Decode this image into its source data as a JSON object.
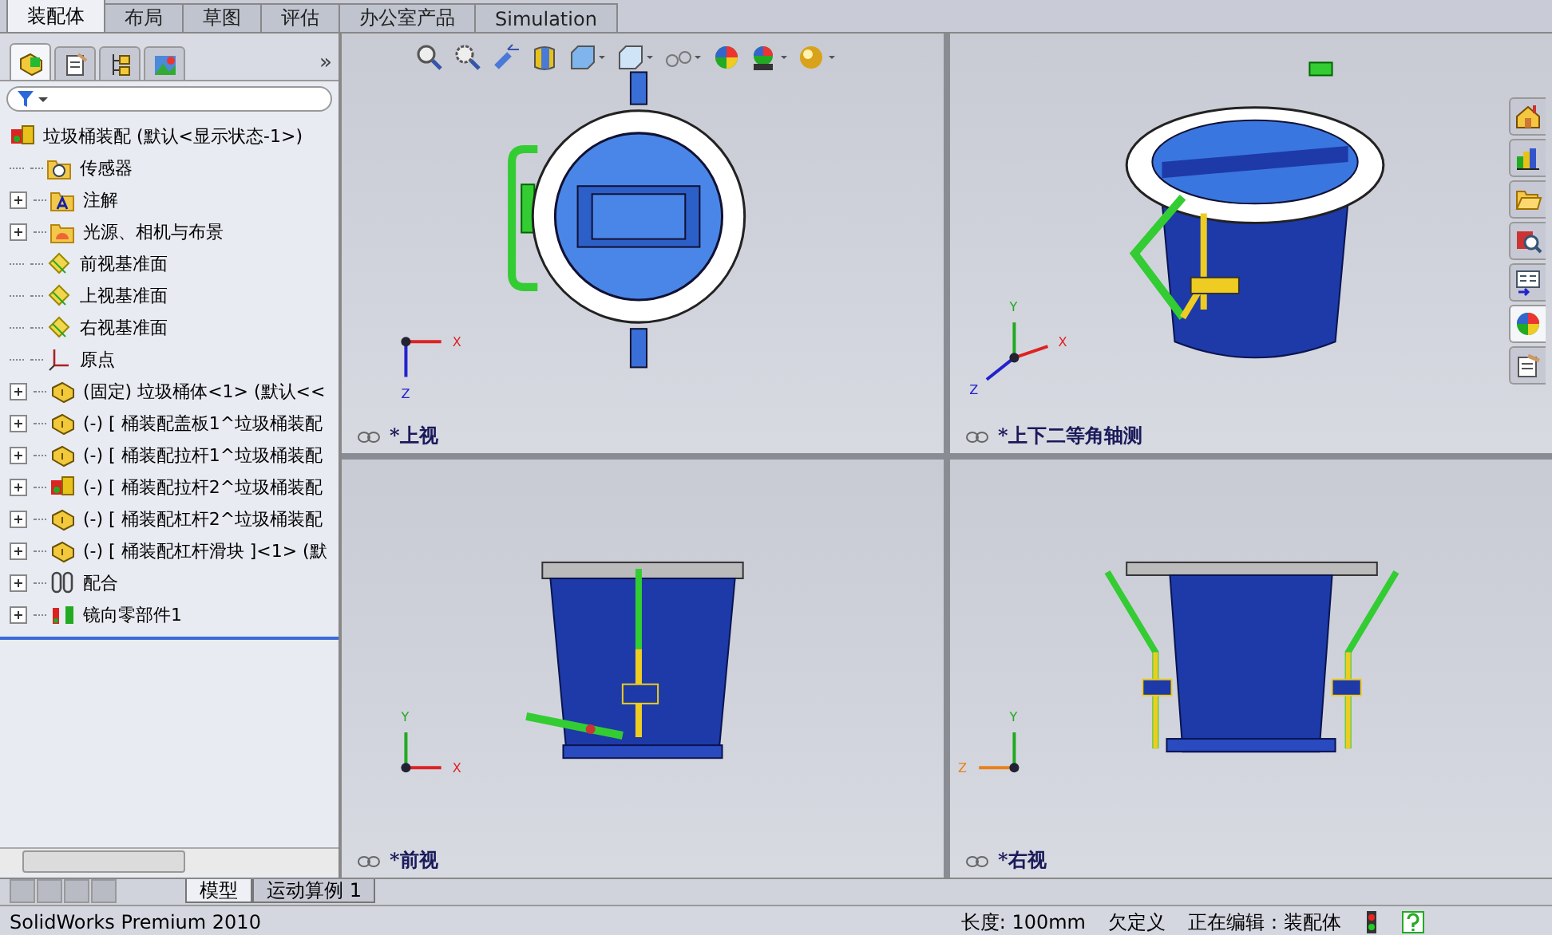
{
  "command_tabs": [
    {
      "label": "装配体",
      "selected": true
    },
    {
      "label": "布局",
      "selected": false
    },
    {
      "label": "草图",
      "selected": false
    },
    {
      "label": "评估",
      "selected": false
    },
    {
      "label": "办公室产品",
      "selected": false
    },
    {
      "label": "Simulation",
      "selected": false
    }
  ],
  "manager_tabs": [
    {
      "kind": "tree",
      "selected": true
    },
    {
      "kind": "property",
      "selected": false
    },
    {
      "kind": "config",
      "selected": false
    },
    {
      "kind": "display",
      "selected": false
    }
  ],
  "manager_more": "»",
  "tree": {
    "root": {
      "label": "垃圾桶装配 (默认<显示状态-1>)",
      "kind": "assembly"
    },
    "items": [
      {
        "label": "传感器",
        "kind": "sensor",
        "expandable": false
      },
      {
        "label": "注解",
        "kind": "annotation",
        "expandable": true
      },
      {
        "label": "光源、相机与布景",
        "kind": "lights",
        "expandable": true
      },
      {
        "label": "前视基准面",
        "kind": "plane",
        "expandable": false
      },
      {
        "label": "上视基准面",
        "kind": "plane",
        "expandable": false
      },
      {
        "label": "右视基准面",
        "kind": "plane",
        "expandable": false
      },
      {
        "label": "原点",
        "kind": "origin",
        "expandable": false
      },
      {
        "label": "(固定) 垃圾桶体<1> (默认<<",
        "kind": "part",
        "expandable": true
      },
      {
        "label": "(-) [ 桶装配盖板1^垃圾桶装配",
        "kind": "part",
        "expandable": true
      },
      {
        "label": "(-) [ 桶装配拉杆1^垃圾桶装配",
        "kind": "part",
        "expandable": true
      },
      {
        "label": "(-) [ 桶装配拉杆2^垃圾桶装配",
        "kind": "subassembly",
        "expandable": true
      },
      {
        "label": "(-) [ 桶装配杠杆2^垃圾桶装配",
        "kind": "part",
        "expandable": true
      },
      {
        "label": "(-) [ 桶装配杠杆滑块 ]<1> (默",
        "kind": "part",
        "expandable": true
      },
      {
        "label": "配合",
        "kind": "mates",
        "expandable": true
      },
      {
        "label": "镜向零部件1",
        "kind": "mirror",
        "expandable": true
      }
    ]
  },
  "viewports": [
    {
      "kind": "top",
      "label": "*上视",
      "axes": [
        {
          "kind": "right",
          "label": "X",
          "color": "#dd2222"
        },
        {
          "kind": "down",
          "label": "Z",
          "color": "#2222cc"
        }
      ]
    },
    {
      "kind": "iso",
      "label": "*上下二等角轴测",
      "axes": [
        {
          "kind": "diagonal",
          "label": "X",
          "color": "#dd2222"
        },
        {
          "kind": "up",
          "label": "Y",
          "color": "#22aa22"
        },
        {
          "kind": "downleft",
          "label": "Z",
          "color": "#2222cc"
        }
      ]
    },
    {
      "kind": "front",
      "label": "*前视",
      "axes": [
        {
          "kind": "right",
          "label": "X",
          "color": "#dd2222"
        },
        {
          "kind": "up",
          "label": "Y",
          "color": "#22aa22"
        }
      ]
    },
    {
      "kind": "right",
      "label": "*右视",
      "axes": [
        {
          "kind": "left",
          "label": "Z",
          "color": "#e8801a"
        },
        {
          "kind": "up",
          "label": "Y",
          "color": "#22aa22"
        }
      ]
    }
  ],
  "task_pane": [
    {
      "kind": "home",
      "selected": false
    },
    {
      "kind": "library",
      "selected": false
    },
    {
      "kind": "folder",
      "selected": false
    },
    {
      "kind": "search",
      "selected": false
    },
    {
      "kind": "palette",
      "selected": false
    },
    {
      "kind": "appearance",
      "selected": true
    },
    {
      "kind": "custom",
      "selected": false
    }
  ],
  "bottom_tabs": [
    {
      "label": "模型",
      "selected": true
    },
    {
      "label": "运动算例 1",
      "selected": false
    }
  ],
  "status_bar": {
    "product": "SolidWorks Premium 2010",
    "length": "长度: 100mm",
    "state": "欠定义",
    "editing": "正在编辑：装配体"
  }
}
